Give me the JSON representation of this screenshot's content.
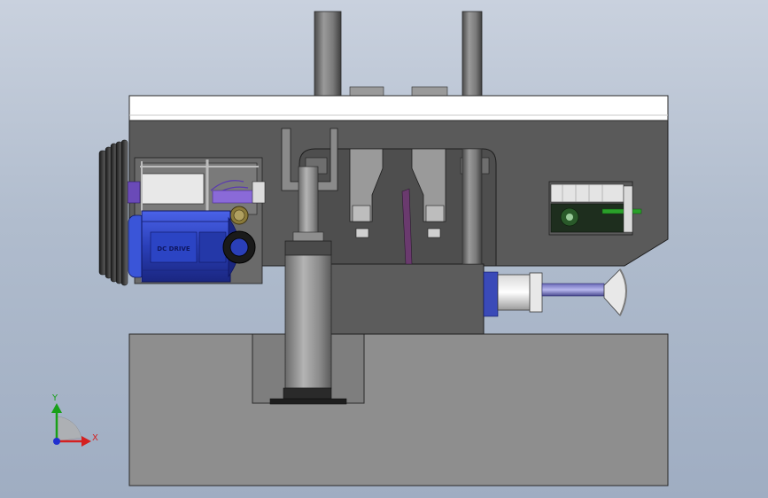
{
  "motor": {
    "label": "DC DRIVE"
  },
  "triad": {
    "x_label": "X",
    "y_label": "Y"
  },
  "colors": {
    "background_top": "#c9d1de",
    "background_bottom": "#9fadc2",
    "base": "#8e8e8e",
    "housing": "#5a5a5a",
    "top_plate": "#ffffff",
    "motor": "#2a3fb8",
    "axis_x": "#d42020",
    "axis_y": "#18a018",
    "axis_z": "#2030d0"
  }
}
